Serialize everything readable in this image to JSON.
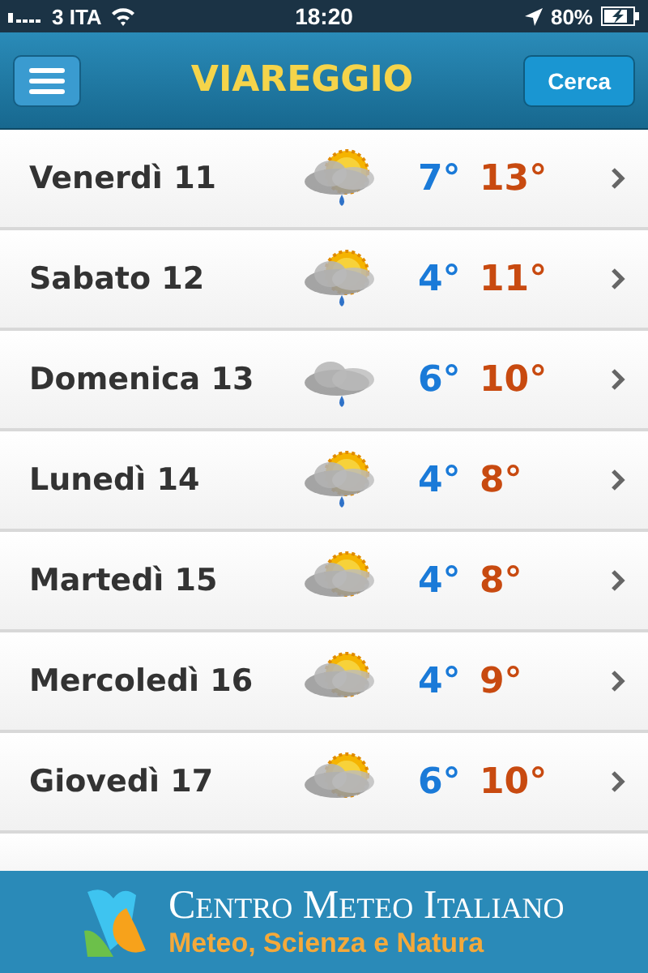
{
  "status_bar": {
    "carrier": "3 ITA",
    "time": "18:20",
    "battery": "80%"
  },
  "header": {
    "title": "VIAREGGIO",
    "search_button": "Cerca"
  },
  "days": [
    {
      "day": "Venerdì 11",
      "kind": "sun-cloud-rain",
      "min": "7°",
      "max": "13°"
    },
    {
      "day": "Sabato 12",
      "kind": "sun-cloud-rain",
      "min": "4°",
      "max": "11°"
    },
    {
      "day": "Domenica 13",
      "kind": "cloud-rain",
      "min": "6°",
      "max": "10°"
    },
    {
      "day": "Lunedì 14",
      "kind": "sun-cloud-rain",
      "min": "4°",
      "max": "8°"
    },
    {
      "day": "Martedì 15",
      "kind": "sun-cloud",
      "min": "4°",
      "max": "8°"
    },
    {
      "day": "Mercoledì 16",
      "kind": "sun-cloud",
      "min": "4°",
      "max": "9°"
    },
    {
      "day": "Giovedì 17",
      "kind": "sun-cloud",
      "min": "6°",
      "max": "10°"
    }
  ],
  "banner": {
    "title": "Centro Meteo Italiano",
    "subtitle": "Meteo, Scienza e Natura"
  }
}
